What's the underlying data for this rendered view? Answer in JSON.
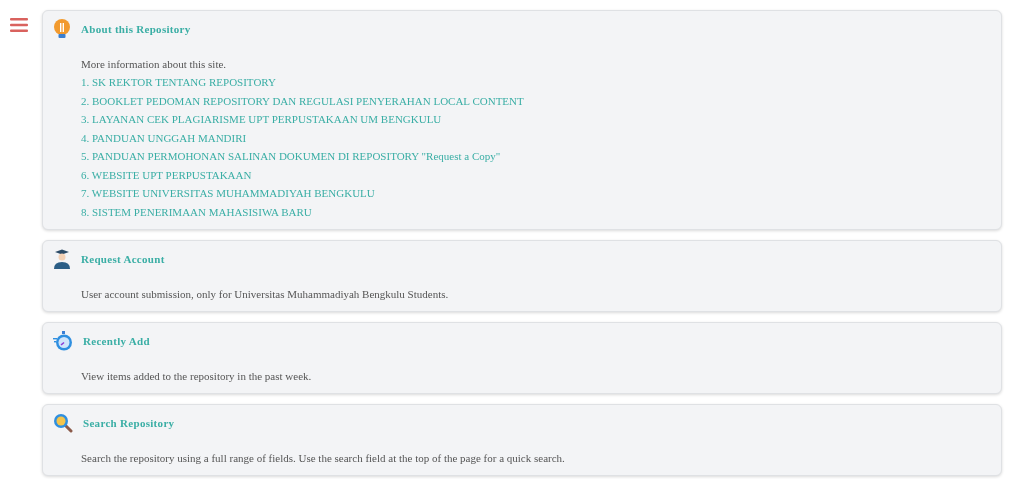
{
  "menu": {
    "kind": "hamburger"
  },
  "cards": [
    {
      "kind": "bulb",
      "title": "About this Repository",
      "description": "More information about this site.",
      "links": [
        "1. SK REKTOR TENTANG REPOSITORY",
        "2. BOOKLET PEDOMAN REPOSITORY DAN REGULASI PENYERAHAN LOCAL CONTENT",
        "3. LAYANAN CEK PLAGIARISME UPT PERPUSTAKAAN UM BENGKULU",
        "4. PANDUAN UNGGAH MANDIRI",
        "5. PANDUAN PERMOHONAN SALINAN DOKUMEN DI REPOSITORY \"Request a Copy\"",
        "6. WEBSITE UPT PERPUSTAKAAN",
        "7. WEBSITE UNIVERSITAS MUHAMMADIYAH BENGKULU",
        "8. SISTEM PENERIMAAN MAHASISIWA BARU"
      ]
    },
    {
      "kind": "graduate",
      "title": "Request Account",
      "description": "User account submission, only for Universitas Muhammadiyah Bengkulu Students."
    },
    {
      "kind": "stopwatch",
      "title": "Recently Add",
      "description": "View items added to the repository in the past week."
    },
    {
      "kind": "search",
      "title": "Search Repository",
      "description": "Search the repository using a full range of fields. Use the search field at the top of the page for a quick search."
    }
  ]
}
